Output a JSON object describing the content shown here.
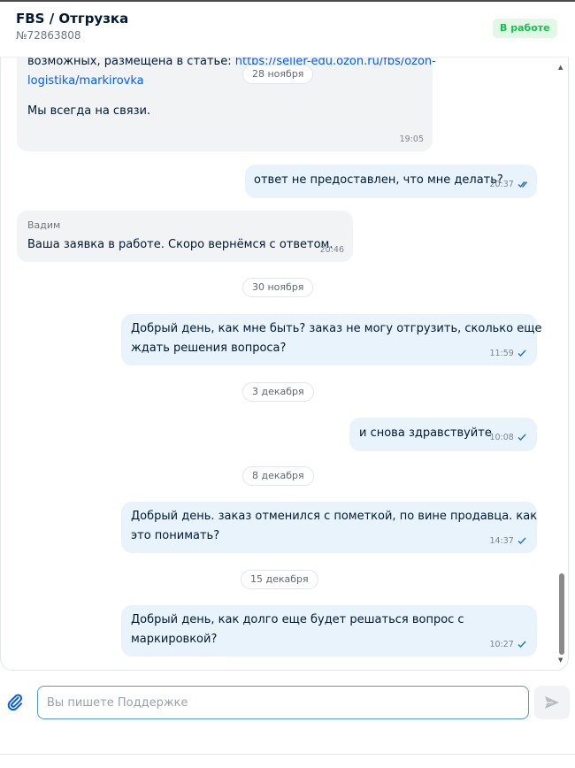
{
  "header": {
    "title": "FBS / Отгрузка",
    "order_number": "№72863808",
    "status": "В работе"
  },
  "colors": {
    "accent": "#005bff",
    "status_bg": "#e3f7e6",
    "status_text": "#10c44c",
    "outgoing_bubble": "#e8f3fb",
    "incoming_bubble": "#f2f3f5"
  },
  "messages": {
    "m1": {
      "line1_text": "возможных, размещена в статье: ",
      "line1_link": "https://seller-edu.ozon.ru/fbs/ozon-",
      "line2_link": "logistika/markirovka",
      "line3": "Мы всегда на связи.",
      "time": "19:05"
    },
    "m2": {
      "text": "ответ не предоставлен, что мне делать?",
      "time": "20:37"
    },
    "m3": {
      "sender": "Вадим",
      "text": "Ваша заявка в работе. Скоро вернёмся с ответом.",
      "time": "20:46"
    },
    "m4": {
      "line1": "Добрый день, как мне быть? заказ не могу отгрузить, сколько еще",
      "line2": "ждать решения вопроса?",
      "time": "11:59"
    },
    "m5": {
      "text": "и снова здравствуйте",
      "time": "10:08"
    },
    "m6": {
      "line1": "Добрый день. заказ отменился с пометкой, по вине продавца. как",
      "line2": "это понимать?",
      "time": "14:37"
    },
    "m7": {
      "line1": "Добрый день, как долго еще будет решаться вопрос с",
      "line2": "маркировкой?",
      "time": "10:27"
    }
  },
  "dates": {
    "d1": "28 ноября",
    "d2": "30 ноября",
    "d3": "3 декабря",
    "d4": "8 декабря",
    "d5": "15 декабря"
  },
  "composer": {
    "placeholder": "Вы пишете Поддержке"
  }
}
